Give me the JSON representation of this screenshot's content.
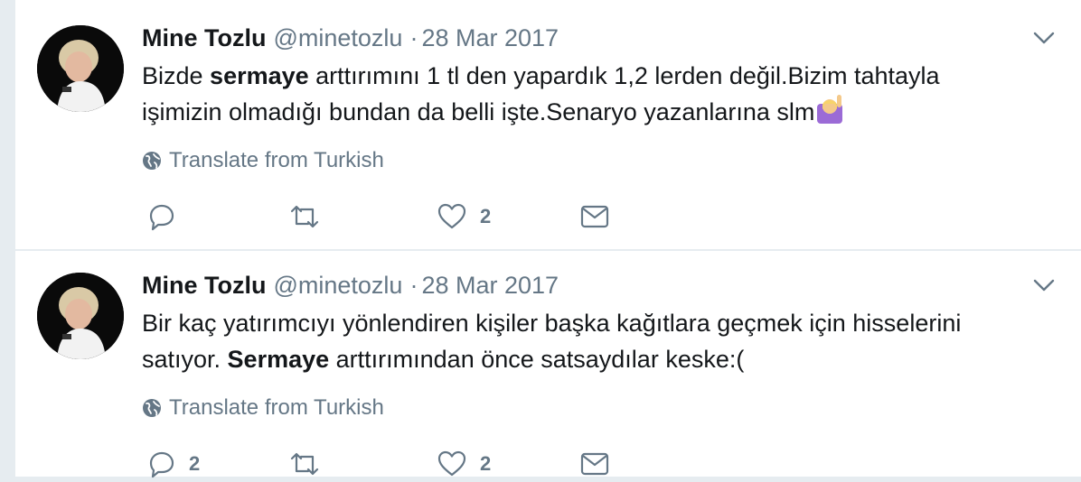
{
  "tweets": [
    {
      "fullname": "Mine Tozlu",
      "username": "@minetozlu",
      "separator": "·",
      "date": "28 Mar 2017",
      "text_parts": {
        "a": "Bizde ",
        "b": "sermaye",
        "c": " arttırımını 1 tl den yapardık 1,2 lerden değil.Bizim tahtayla işimizin olmadığı bundan da belli işte.Senaryo yazanlarına slm"
      },
      "translate": "Translate from Turkish",
      "reply_count": "",
      "retweet_count": "",
      "like_count": "2"
    },
    {
      "fullname": "Mine Tozlu",
      "username": "@minetozlu",
      "separator": "·",
      "date": "28 Mar 2017",
      "text_parts": {
        "a": "Bir kaç yatırımcıyı yönlendiren kişiler başka kağıtlara geçmek için hisselerini satıyor. ",
        "b": "Sermaye",
        "c": " arttırımından önce satsaydılar keske:("
      },
      "translate": "Translate from Turkish",
      "reply_count": "2",
      "retweet_count": "",
      "like_count": "2"
    }
  ],
  "icons": {
    "more": "chevron-down-icon",
    "globe": "globe-icon",
    "reply": "reply-icon",
    "retweet": "retweet-icon",
    "like": "heart-icon",
    "dm": "envelope-icon"
  },
  "colors": {
    "text": "#14171a",
    "secondary": "#657786",
    "divider": "#e6ecf0"
  }
}
